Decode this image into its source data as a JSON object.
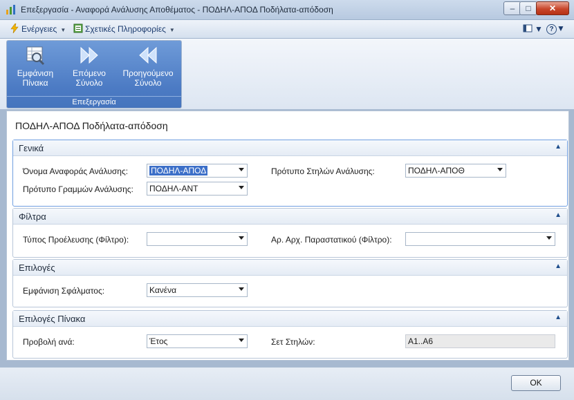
{
  "window": {
    "title": "Επεξεργασία - Αναφορά Ανάλυσης Αποθέματος - ΠΟΔΗΛ-ΑΠΟΔ Ποδήλατα-απόδοση",
    "minimize": "–",
    "maximize": "□",
    "close": "✕"
  },
  "menubar": {
    "actions_label": "Ενέργειες",
    "related_label": "Σχετικές Πληροφορίες",
    "help": "?"
  },
  "ribbon": {
    "group_label": "Επεξεργασία",
    "buttons": [
      {
        "line1": "Εμφάνιση",
        "line2": "Πίνακα"
      },
      {
        "line1": "Επόμενο",
        "line2": "Σύνολο"
      },
      {
        "line1": "Προηγούμενο",
        "line2": "Σύνολο"
      }
    ]
  },
  "page": {
    "title": "ΠΟΔΗΛ-ΑΠΟΔ Ποδήλατα-απόδοση"
  },
  "general": {
    "header": "Γενικά",
    "analysis_report_label": "Όνομα Αναφοράς Ανάλυσης:",
    "analysis_report_value": "ΠΟΔΗΛ-ΑΠΟΔ",
    "line_template_label": "Πρότυπο Γραμμών Ανάλυσης:",
    "line_template_value": "ΠΟΔΗΛ-ΑΝΤ",
    "column_template_label": "Πρότυπο Στηλών Ανάλυσης:",
    "column_template_value": "ΠΟΔΗΛ-ΑΠΟΘ"
  },
  "filters": {
    "header": "Φίλτρα",
    "source_type_label": "Τύπος Προέλευσης (Φίλτρο):",
    "source_type_value": "",
    "document_no_label": "Αρ. Αρχ. Παραστατικού (Φίλτρο):",
    "document_no_value": ""
  },
  "options": {
    "header": "Επιλογές",
    "show_error_label": "Εμφάνιση Σφάλματος:",
    "show_error_value": "Κανένα"
  },
  "matrix_options": {
    "header": "Επιλογές Πίνακα",
    "view_by_label": "Προβολή ανά:",
    "view_by_value": "Έτος",
    "column_set_label": "Σετ Στηλών:",
    "column_set_value": "Α1..Α6"
  },
  "footer": {
    "ok_label": "OK"
  }
}
